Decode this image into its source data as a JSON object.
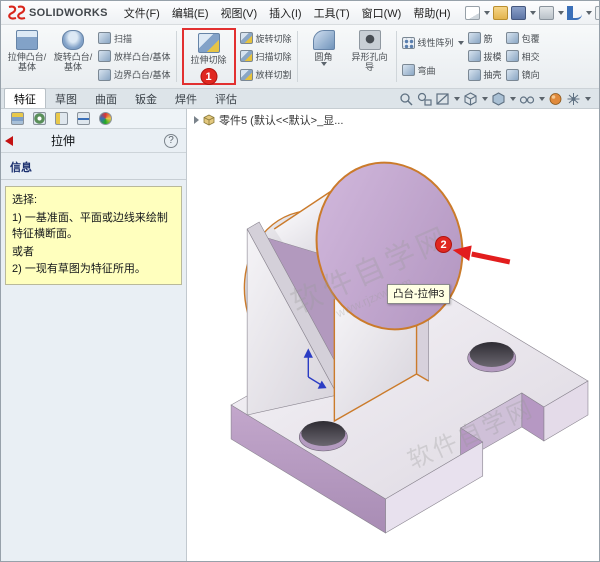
{
  "app": {
    "logo_text": "SOLIDWORKS",
    "menus": [
      "文件(F)",
      "编辑(E)",
      "视图(V)",
      "插入(I)",
      "工具(T)",
      "窗口(W)",
      "帮助(H)"
    ],
    "quick_icon_names": [
      "new-document-icon",
      "open-icon",
      "save-icon",
      "print-icon",
      "undo-icon",
      "rebuild-icon",
      "options-icon"
    ]
  },
  "ribbon": {
    "extrude_boss": "拉伸凸台/基体",
    "revolve_boss": "旋转凸台/基体",
    "swept_boss": "扫描",
    "lofted_boss": "放样凸台/基体",
    "boundary_boss": "边界凸台/基体",
    "extrude_cut": "拉伸切除",
    "revolve_cut": "旋转切除",
    "swept_cut": "扫描切除",
    "lofted_cut": "放样切割",
    "fillet": "圆角",
    "hole_wizard": "异形孔向导",
    "linear_pattern": "线性阵列",
    "flex": "弯曲",
    "rib": "筋",
    "draft": "拔模",
    "shell": "抽壳",
    "wrap": "包覆",
    "intersect": "相交",
    "mirror": "镜向",
    "step_badge": "1"
  },
  "tabs": [
    "特征",
    "草图",
    "曲面",
    "钣金",
    "焊件",
    "评估"
  ],
  "property_panel": {
    "title": "拉伸",
    "help": "?",
    "info_header": "信息",
    "message": {
      "line1": "选择:",
      "line2": "1) 一基准面、平面或边线来绘制特征横断面。",
      "line3": "或者",
      "line4": "2) 一现有草图为特征所用。"
    }
  },
  "viewport": {
    "tree_item": "零件5 (默认<<默认>_显...",
    "tooltip": "凸台-拉伸3",
    "step_badge": "2",
    "watermark_text": "软件自学网",
    "watermark_url": "www.rjzxw.com"
  },
  "colors": {
    "highlight_red": "#e02020",
    "selected_edge_orange": "#cb7b2b",
    "face_purple": "#c2a7cc",
    "message_yellow": "#ffffbe",
    "logo_red": "#d9261c"
  }
}
